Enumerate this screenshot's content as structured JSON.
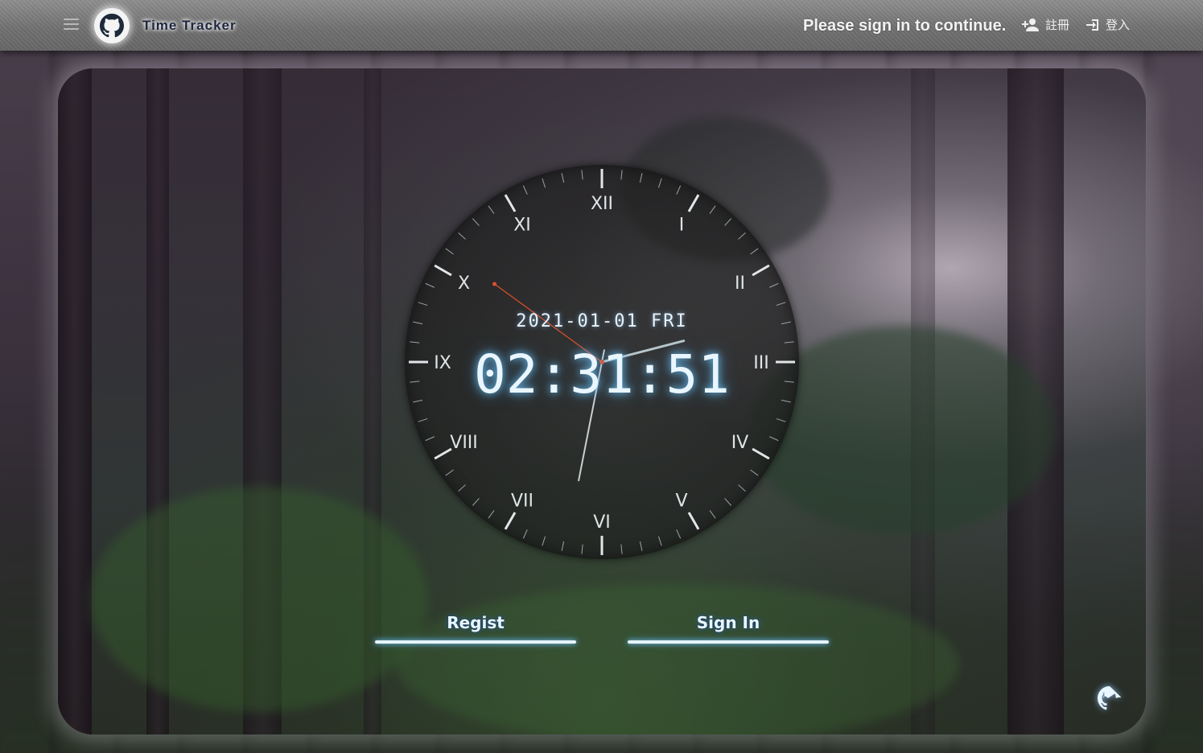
{
  "header": {
    "app_title": "Time Tracker",
    "signin_message": "Please sign in to continue.",
    "register_label": "註冊",
    "login_label": "登入"
  },
  "icons": {
    "menu": "hamburger-menu-icon",
    "logo": "github-icon",
    "register": "person-add-icon",
    "login": "login-icon",
    "footer": "github-icon"
  },
  "clock": {
    "date": "2021-01-01 FRI",
    "time": "02:31:51",
    "numerals": [
      "XII",
      "I",
      "II",
      "III",
      "IV",
      "V",
      "VI",
      "VII",
      "VIII",
      "IX",
      "X",
      "XI"
    ],
    "hour": 2,
    "minute": 31,
    "second": 51
  },
  "buttons": {
    "regist_label": "Regist",
    "signin_label": "Sign In"
  },
  "colors": {
    "glow": "#7cc8ff",
    "second_hand": "#e0502a",
    "title_text": "#1d2540"
  }
}
